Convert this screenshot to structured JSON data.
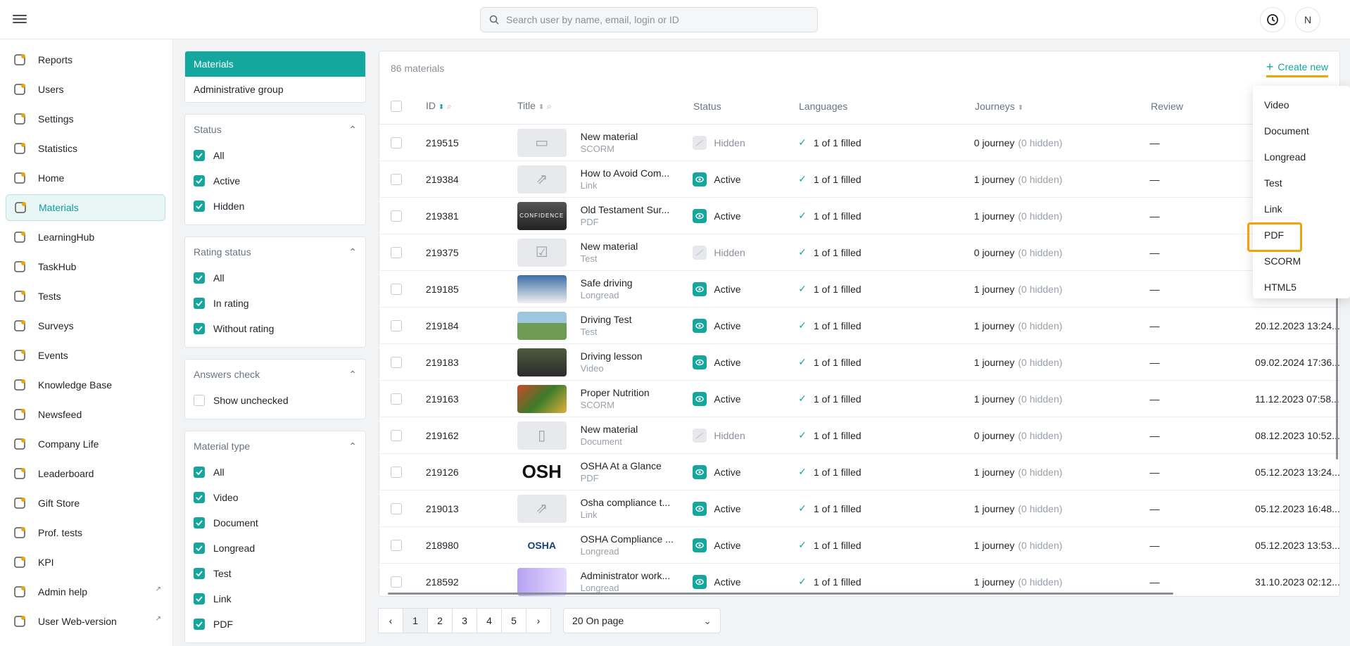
{
  "search": {
    "placeholder": "Search user by name, email, login or ID"
  },
  "user": {
    "initial": "N"
  },
  "sidebar": {
    "items": [
      {
        "label": "Reports",
        "icon": "reports-icon"
      },
      {
        "label": "Users",
        "icon": "users-icon"
      },
      {
        "label": "Settings",
        "icon": "gear-icon"
      },
      {
        "label": "Statistics",
        "icon": "chart-icon"
      },
      {
        "label": "Home",
        "icon": "home-icon"
      },
      {
        "label": "Materials",
        "icon": "document-icon",
        "active": true
      },
      {
        "label": "LearningHub",
        "icon": "hub-icon"
      },
      {
        "label": "TaskHub",
        "icon": "task-icon"
      },
      {
        "label": "Tests",
        "icon": "tests-icon"
      },
      {
        "label": "Surveys",
        "icon": "survey-icon"
      },
      {
        "label": "Events",
        "icon": "calendar-icon"
      },
      {
        "label": "Knowledge Base",
        "icon": "info-icon"
      },
      {
        "label": "Newsfeed",
        "icon": "news-icon"
      },
      {
        "label": "Company Life",
        "icon": "company-icon"
      },
      {
        "label": "Leaderboard",
        "icon": "trophy-icon"
      },
      {
        "label": "Gift Store",
        "icon": "gift-icon"
      },
      {
        "label": "Prof. tests",
        "icon": "prof-icon"
      },
      {
        "label": "KPI",
        "icon": "kpi-icon"
      },
      {
        "label": "Admin help",
        "icon": "star-icon",
        "external": true
      },
      {
        "label": "User Web-version",
        "icon": "monitor-icon",
        "external": true
      }
    ]
  },
  "tabs": [
    "Materials",
    "Administrative group"
  ],
  "filters": {
    "status": {
      "title": "Status",
      "items": [
        "All",
        "Active",
        "Hidden"
      ]
    },
    "rating": {
      "title": "Rating status",
      "items": [
        "All",
        "In rating",
        "Without rating"
      ]
    },
    "answers": {
      "title": "Answers check",
      "items": [
        "Show unchecked"
      ]
    },
    "type": {
      "title": "Material type",
      "items": [
        "All",
        "Video",
        "Document",
        "Longread",
        "Test",
        "Link",
        "PDF"
      ]
    }
  },
  "table": {
    "count": "86 materials",
    "create_label": "Create new",
    "headers": {
      "id": "ID",
      "title": "Title",
      "status": "Status",
      "languages": "Languages",
      "journeys": "Journeys",
      "review": "Review"
    },
    "rows": [
      {
        "id": "219515",
        "title": "New material",
        "type": "SCORM",
        "status": "Hidden",
        "lang": "1 of 1 filled",
        "jn": "0 journey",
        "jh": "(0 hidden)",
        "rev": "—",
        "date": "",
        "thumb": "scorm"
      },
      {
        "id": "219384",
        "title": "How to Avoid Com...",
        "type": "Link",
        "status": "Active",
        "lang": "1 of 1 filled",
        "jn": "1 journey",
        "jh": "(0 hidden)",
        "rev": "—",
        "date": "",
        "thumb": "link"
      },
      {
        "id": "219381",
        "title": "Old Testament Sur...",
        "type": "PDF",
        "status": "Active",
        "lang": "1 of 1 filled",
        "jn": "1 journey",
        "jh": "(0 hidden)",
        "rev": "—",
        "date": "",
        "thumb": "confidence"
      },
      {
        "id": "219375",
        "title": "New material",
        "type": "Test",
        "status": "Hidden",
        "lang": "1 of 1 filled",
        "jn": "0 journey",
        "jh": "(0 hidden)",
        "rev": "—",
        "date": "",
        "thumb": "test"
      },
      {
        "id": "219185",
        "title": "Safe driving",
        "type": "Longread",
        "status": "Active",
        "lang": "1 of 1 filled",
        "jn": "1 journey",
        "jh": "(0 hidden)",
        "rev": "—",
        "date": "",
        "thumb": "car"
      },
      {
        "id": "219184",
        "title": "Driving Test",
        "type": "Test",
        "status": "Active",
        "lang": "1 of 1 filled",
        "jn": "1 journey",
        "jh": "(0 hidden)",
        "rev": "—",
        "date": "20.12.2023 13:24...",
        "thumb": "road"
      },
      {
        "id": "219183",
        "title": "Driving lesson",
        "type": "Video",
        "status": "Active",
        "lang": "1 of 1 filled",
        "jn": "1 journey",
        "jh": "(0 hidden)",
        "rev": "—",
        "date": "09.02.2024 17:36...",
        "thumb": "lesson"
      },
      {
        "id": "219163",
        "title": "Proper Nutrition",
        "type": "SCORM",
        "status": "Active",
        "lang": "1 of 1 filled",
        "jn": "1 journey",
        "jh": "(0 hidden)",
        "rev": "—",
        "date": "11.12.2023 07:58...",
        "thumb": "food"
      },
      {
        "id": "219162",
        "title": "New material",
        "type": "Document",
        "status": "Hidden",
        "lang": "1 of 1 filled",
        "jn": "0 journey",
        "jh": "(0 hidden)",
        "rev": "—",
        "date": "08.12.2023 10:52...",
        "thumb": "doc"
      },
      {
        "id": "219126",
        "title": "OSHA At a Glance",
        "type": "PDF",
        "status": "Active",
        "lang": "1 of 1 filled",
        "jn": "1 journey",
        "jh": "(0 hidden)",
        "rev": "—",
        "date": "05.12.2023 13:24...",
        "thumb": "osha1"
      },
      {
        "id": "219013",
        "title": "Osha compliance t...",
        "type": "Link",
        "status": "Active",
        "lang": "1 of 1 filled",
        "jn": "1 journey",
        "jh": "(0 hidden)",
        "rev": "—",
        "date": "05.12.2023 16:48...",
        "thumb": "link"
      },
      {
        "id": "218980",
        "title": "OSHA Compliance ...",
        "type": "Longread",
        "status": "Active",
        "lang": "1 of 1 filled",
        "jn": "1 journey",
        "jh": "(0 hidden)",
        "rev": "—",
        "date": "05.12.2023 13:53...",
        "thumb": "osha2"
      },
      {
        "id": "218592",
        "title": "Administrator work...",
        "type": "Longread",
        "status": "Active",
        "lang": "1 of 1 filled",
        "jn": "1 journey",
        "jh": "(0 hidden)",
        "rev": "—",
        "date": "31.10.2023 02:12...",
        "thumb": "admin"
      }
    ]
  },
  "dropdown": {
    "items": [
      "Video",
      "Document",
      "Longread",
      "Test",
      "Link",
      "PDF",
      "SCORM",
      "HTML5"
    ],
    "highlighted": "PDF"
  },
  "pagination": {
    "pages": [
      "1",
      "2",
      "3",
      "4",
      "5"
    ],
    "current": "1",
    "per_page": "20 On page"
  },
  "colors": {
    "accent": "#14a79d",
    "highlight": "#f0a30a"
  }
}
